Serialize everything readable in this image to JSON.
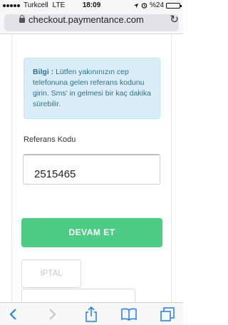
{
  "status_bar": {
    "carrier": "Turkcell",
    "network": "LTE",
    "time": "18:09",
    "battery": "%24",
    "battery_level": 0.24
  },
  "browser": {
    "url": "checkout.paymentance.com"
  },
  "form": {
    "info_title": "Bilgi :",
    "info_text": "Lütfen yakınınızın cep telefonuna gelen referans kodunu girin. Sms' in gelmesi bir kaç dakika sürebilir.",
    "ref_label": "Referans Kodu",
    "ref_value": "2515465",
    "continue_label": "DEVAM ET",
    "cancel_label": "İPTAL"
  },
  "colors": {
    "info_bg": "#d9edf7",
    "info_text": "#31708f",
    "continue_bg": "#4ccc84",
    "ios_blue": "#1a7cf5"
  },
  "toolbar": {
    "icons": [
      "back-icon",
      "forward-icon",
      "share-icon",
      "bookmarks-icon",
      "tabs-icon"
    ]
  }
}
